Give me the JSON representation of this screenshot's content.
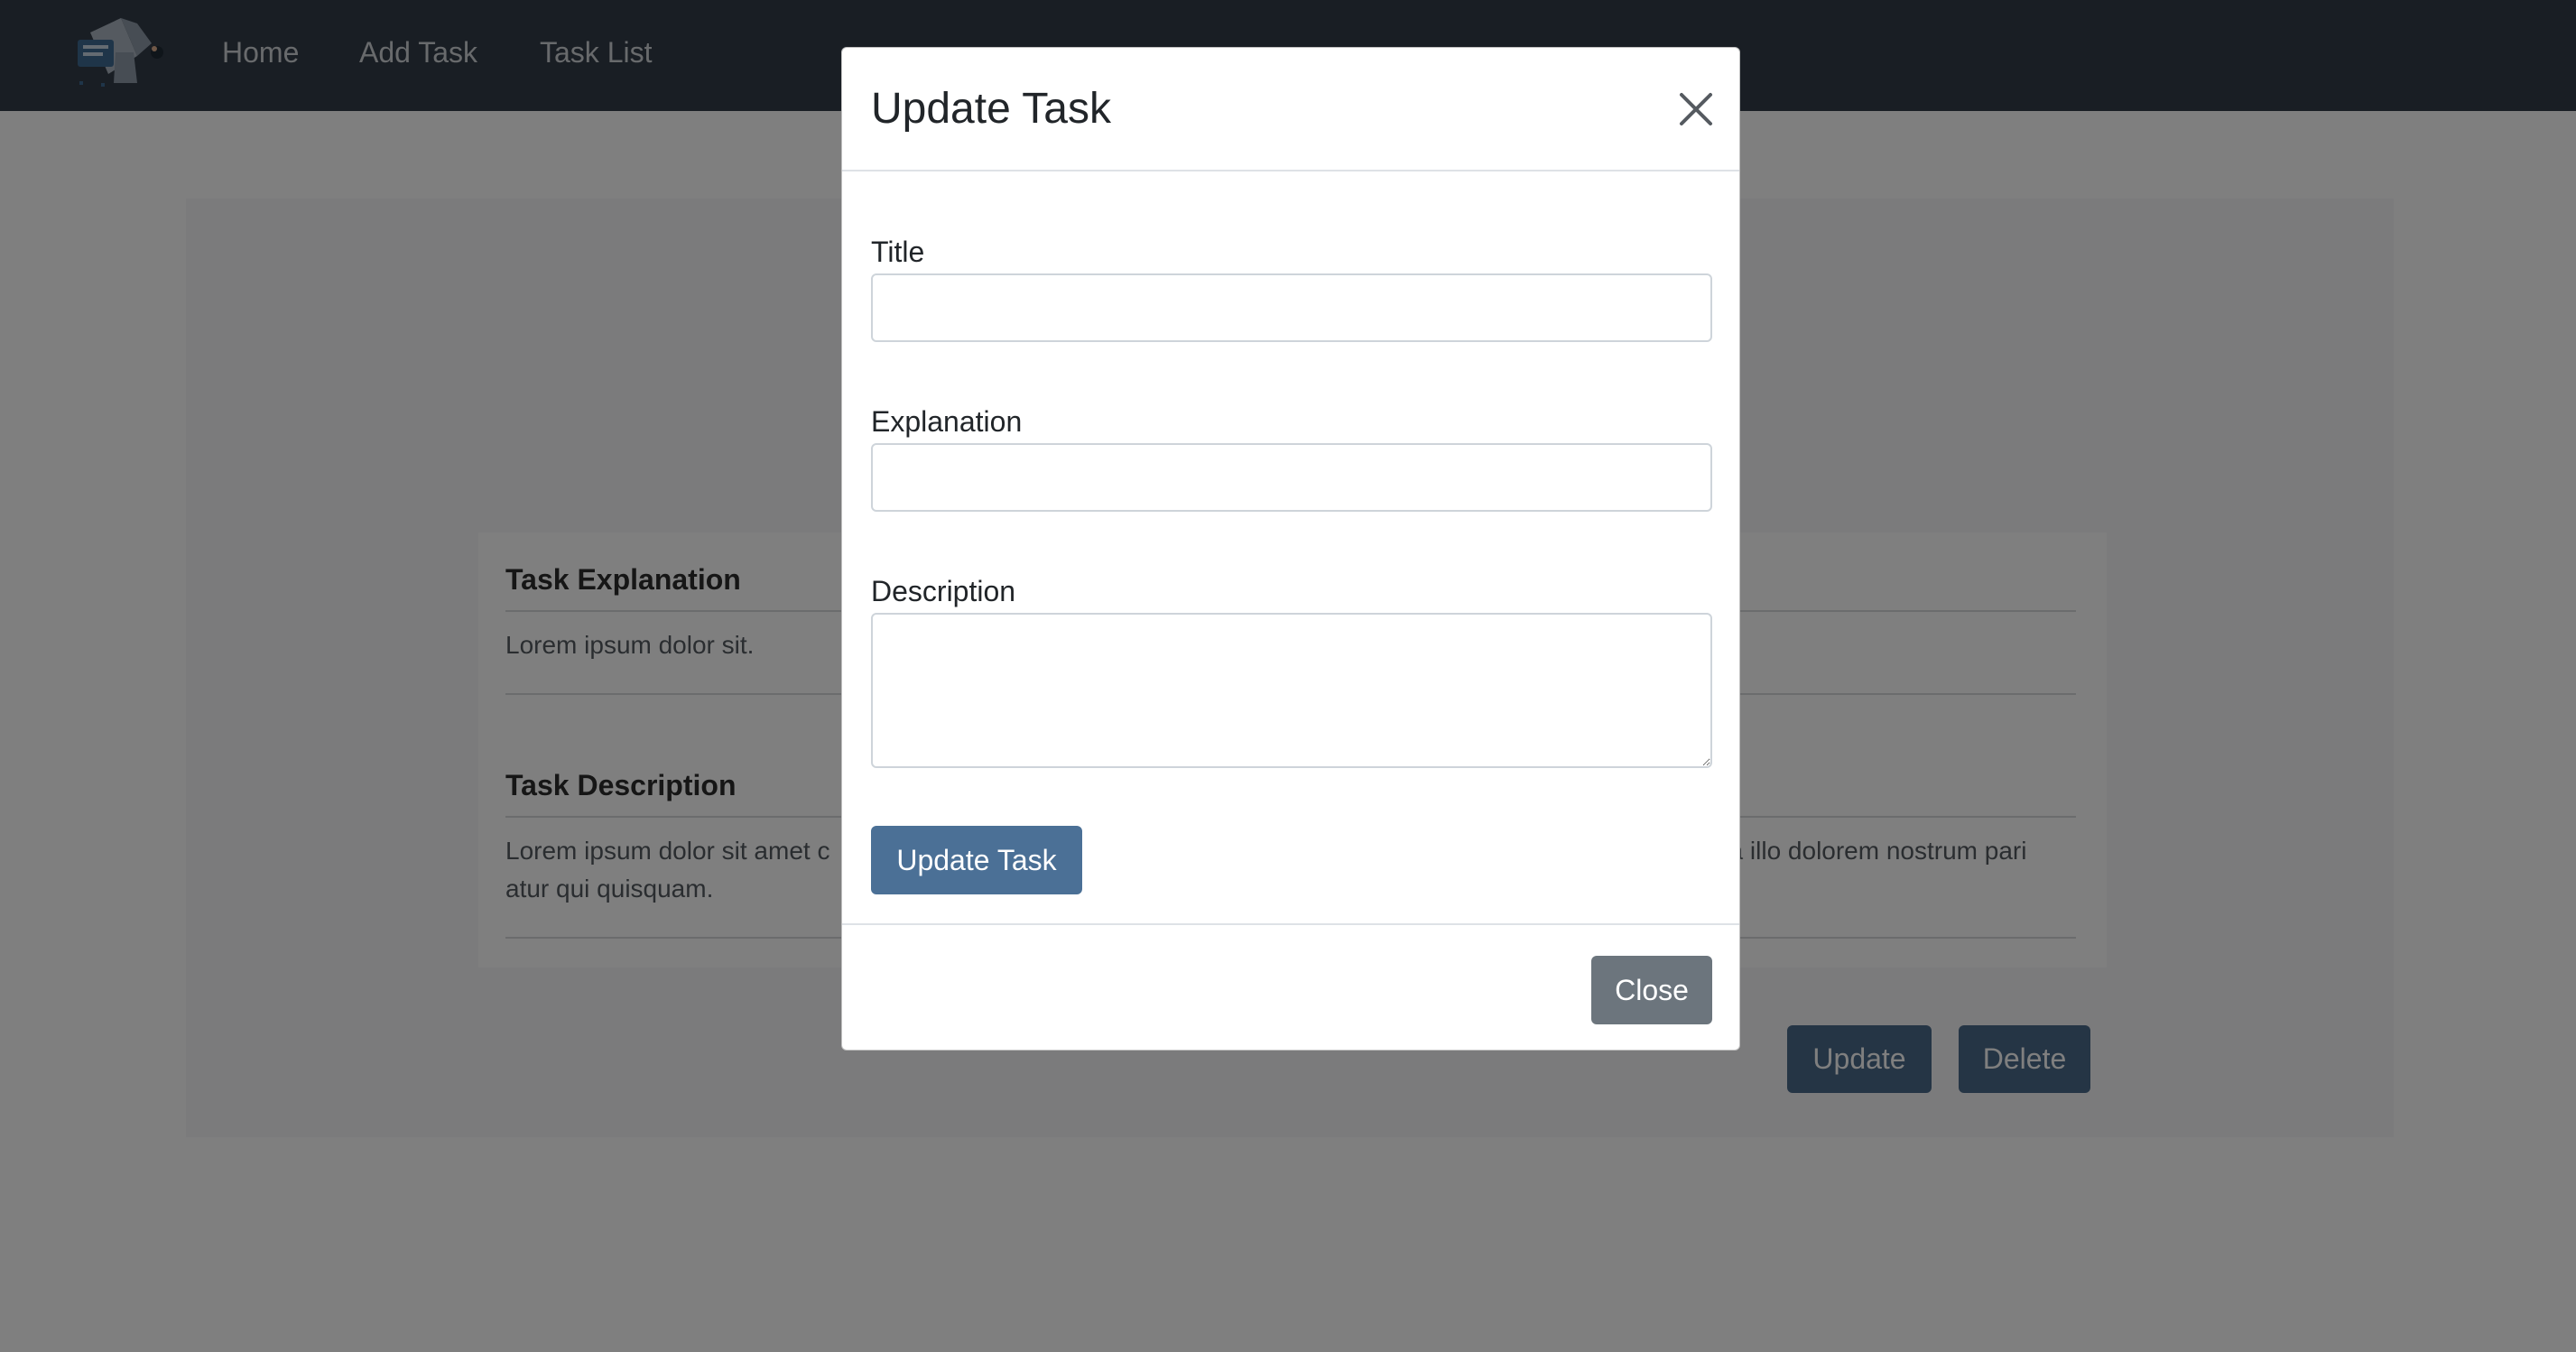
{
  "navbar": {
    "logo_icon": "task-board-logo-icon",
    "links": [
      {
        "label": "Home"
      },
      {
        "label": "Add Task"
      },
      {
        "label": "Task List"
      }
    ]
  },
  "task_detail": {
    "explanation_heading": "Task Explanation",
    "explanation_text": "Lorem ipsum dolor sit.",
    "description_heading": "Task Description",
    "description_text_left_line1": "Lorem ipsum dolor sit amet c",
    "description_text_right_line1": "t a illo dolorem nostrum pari",
    "description_text_line2": "atur qui quisquam.",
    "update_label": "Update",
    "delete_label": "Delete"
  },
  "modal": {
    "title": "Update Task",
    "close_icon": "close-icon",
    "fields": {
      "title_label": "Title",
      "title_value": "",
      "explanation_label": "Explanation",
      "explanation_value": "",
      "description_label": "Description",
      "description_value": ""
    },
    "submit_label": "Update Task",
    "close_label": "Close"
  },
  "colors": {
    "navbar_bg": "#333d48",
    "primary_button": "#4b7096",
    "secondary_button": "#6c757d",
    "page_button": "#4b6a8a"
  }
}
